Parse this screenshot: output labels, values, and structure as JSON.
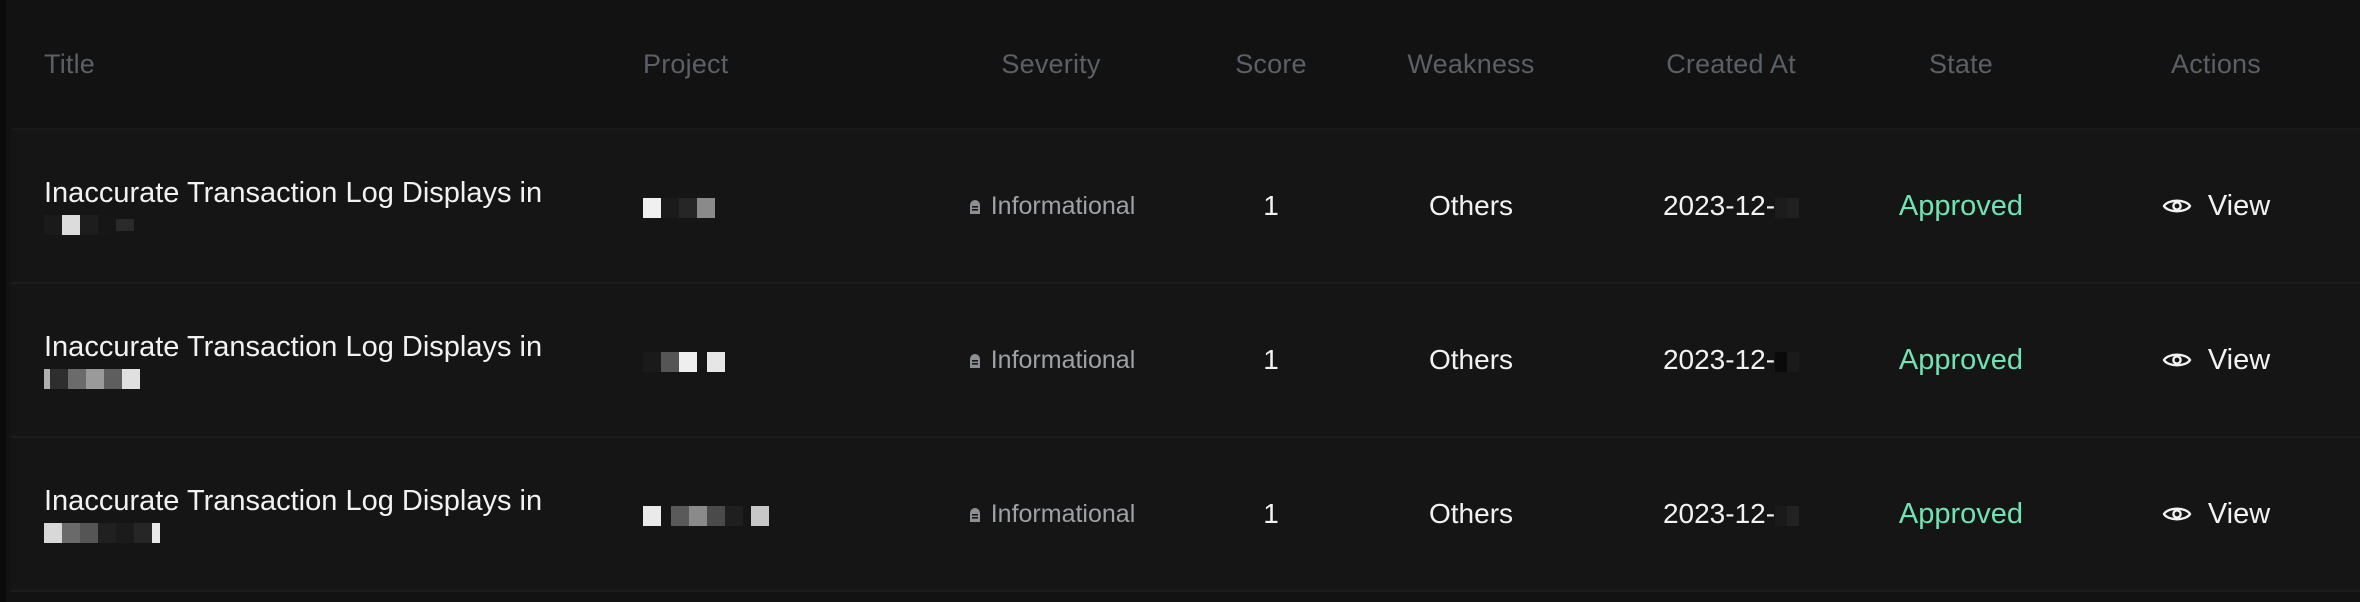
{
  "table": {
    "columns": {
      "title": "Title",
      "project": "Project",
      "severity": "Severity",
      "score": "Score",
      "weakness": "Weakness",
      "created_at": "Created At",
      "state": "State",
      "actions": "Actions"
    },
    "rows": [
      {
        "title": "Inaccurate Transaction Log Displays in",
        "severity": "Informational",
        "severity_icon": "tombstone-icon",
        "score": "1",
        "weakness": "Others",
        "created_at": "2023-12-",
        "state": "Approved",
        "action": "View",
        "action_icon": "eye-icon"
      },
      {
        "title": "Inaccurate Transaction Log Displays in",
        "severity": "Informational",
        "severity_icon": "tombstone-icon",
        "score": "1",
        "weakness": "Others",
        "created_at": "2023-12-",
        "state": "Approved",
        "action": "View",
        "action_icon": "eye-icon"
      },
      {
        "title": "Inaccurate Transaction Log Displays in",
        "severity": "Informational",
        "severity_icon": "tombstone-icon",
        "score": "1",
        "weakness": "Others",
        "created_at": "2023-12-",
        "state": "Approved",
        "action": "View",
        "action_icon": "eye-icon"
      }
    ]
  },
  "colors": {
    "background": "#121212",
    "row_background": "#151515",
    "header_text": "#5b5f66",
    "state_approved": "#6fe3b2",
    "severity_text": "#9ea1a6"
  }
}
